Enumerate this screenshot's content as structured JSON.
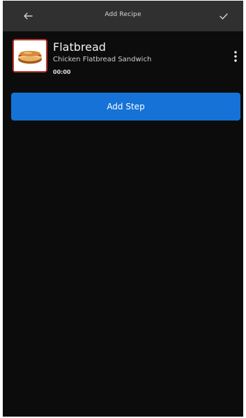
{
  "header": {
    "title": "Add Recipe",
    "back_icon": "arrow-left-icon",
    "done_icon": "check-icon"
  },
  "recipe": {
    "name": "Flatbread",
    "description": "Chicken Flatbread Sandwich",
    "time": "00:00",
    "thumbnail": "flatbread-sandwich-image",
    "menu_icon": "more-vertical-icon"
  },
  "actions": {
    "add_step_label": "Add Step"
  },
  "colors": {
    "background": "#0c0c0c",
    "appbar": "#303030",
    "accent": "#1672d6",
    "thumbnail_border": "#c0392b"
  }
}
